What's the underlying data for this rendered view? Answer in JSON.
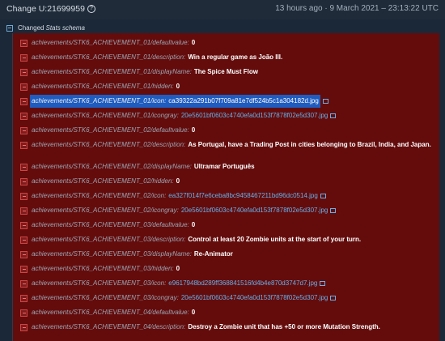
{
  "header": {
    "title": "Change U:21699959",
    "timestamp": "13 hours ago · 9 March 2021 – 23:13:22 UTC"
  },
  "section": {
    "label": "Changed",
    "schema": "Stats schema"
  },
  "rows": [
    {
      "key": "achievements/STK6_ACHIEVEMENT_01/defaultvalue:",
      "value": "0",
      "type": "bold"
    },
    {
      "key": "achievements/STK6_ACHIEVEMENT_01/description:",
      "value": "Win a regular game as João III.",
      "type": "bold"
    },
    {
      "key": "achievements/STK6_ACHIEVEMENT_01/displayName:",
      "value": "The Spice Must Flow",
      "type": "bold"
    },
    {
      "key": "achievements/STK6_ACHIEVEMENT_01/hidden:",
      "value": "0",
      "type": "bold"
    },
    {
      "key": "achievements/STK6_ACHIEVEMENT_01/icon:",
      "value": "ca39322a291b07f709a81e7df524b5c1a304182d.jpg",
      "type": "selected"
    },
    {
      "key": "achievements/STK6_ACHIEVEMENT_01/icongray:",
      "value": "20e5601bf0603c4740efa0d153f7878f02e5d307.jpg",
      "type": "link"
    },
    {
      "key": "achievements/STK6_ACHIEVEMENT_02/defaultvalue:",
      "value": "0",
      "type": "bold"
    },
    {
      "key": "achievements/STK6_ACHIEVEMENT_02/description:",
      "value": "As Portugal, have a Trading Post in cities belonging to Brazil, India, and Japan.",
      "type": "bold-wrap"
    },
    {
      "key": "achievements/STK6_ACHIEVEMENT_02/displayName:",
      "value": "Ultramar Português",
      "type": "bold"
    },
    {
      "key": "achievements/STK6_ACHIEVEMENT_02/hidden:",
      "value": "0",
      "type": "bold"
    },
    {
      "key": "achievements/STK6_ACHIEVEMENT_02/icon:",
      "value": "ea327f014f7e6ceba8bc9458467211bd96dc0514.jpg",
      "type": "link"
    },
    {
      "key": "achievements/STK6_ACHIEVEMENT_02/icongray:",
      "value": "20e5601bf0603c4740efa0d153f7878f02e5d307.jpg",
      "type": "link"
    },
    {
      "key": "achievements/STK6_ACHIEVEMENT_03/defaultvalue:",
      "value": "0",
      "type": "bold"
    },
    {
      "key": "achievements/STK6_ACHIEVEMENT_03/description:",
      "value": "Control at least 20 Zombie units at the start of your turn.",
      "type": "bold"
    },
    {
      "key": "achievements/STK6_ACHIEVEMENT_03/displayName:",
      "value": "Re-Animator",
      "type": "bold"
    },
    {
      "key": "achievements/STK6_ACHIEVEMENT_03/hidden:",
      "value": "0",
      "type": "bold"
    },
    {
      "key": "achievements/STK6_ACHIEVEMENT_03/icon:",
      "value": "e9617948bd289ff368841516fd4b4e870d3747d7.jpg",
      "type": "link"
    },
    {
      "key": "achievements/STK6_ACHIEVEMENT_03/icongray:",
      "value": "20e5601bf0603c4740efa0d153f7878f02e5d307.jpg",
      "type": "link"
    },
    {
      "key": "achievements/STK6_ACHIEVEMENT_04/defaultvalue:",
      "value": "0",
      "type": "bold"
    },
    {
      "key": "achievements/STK6_ACHIEVEMENT_04/description:",
      "value": "Destroy a Zombie unit that has +50 or more Mutation Strength.",
      "type": "bold"
    }
  ]
}
